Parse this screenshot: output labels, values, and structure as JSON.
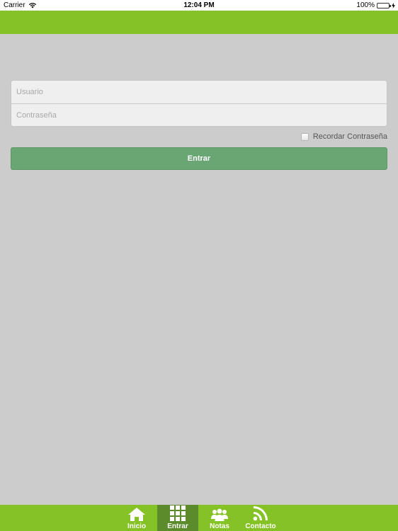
{
  "status_bar": {
    "carrier": "Carrier",
    "time": "12:04 PM",
    "battery": "100%"
  },
  "login": {
    "username_placeholder": "Usuario",
    "password_placeholder": "Contraseña",
    "remember_label": "Recordar Contraseña",
    "remember_checked": false,
    "submit_label": "Entrar"
  },
  "tabs": [
    {
      "label": "Inicio",
      "icon": "home-icon",
      "active": false
    },
    {
      "label": "Entrar",
      "icon": "grid-icon",
      "active": true
    },
    {
      "label": "Notas",
      "icon": "people-icon",
      "active": false
    },
    {
      "label": "Contacto",
      "icon": "rss-icon",
      "active": false
    }
  ],
  "colors": {
    "header": "#84c225",
    "tab_bar": "#84c225",
    "tab_active": "#5b8b2a",
    "background": "#cccccc",
    "button": "#6aa574"
  }
}
